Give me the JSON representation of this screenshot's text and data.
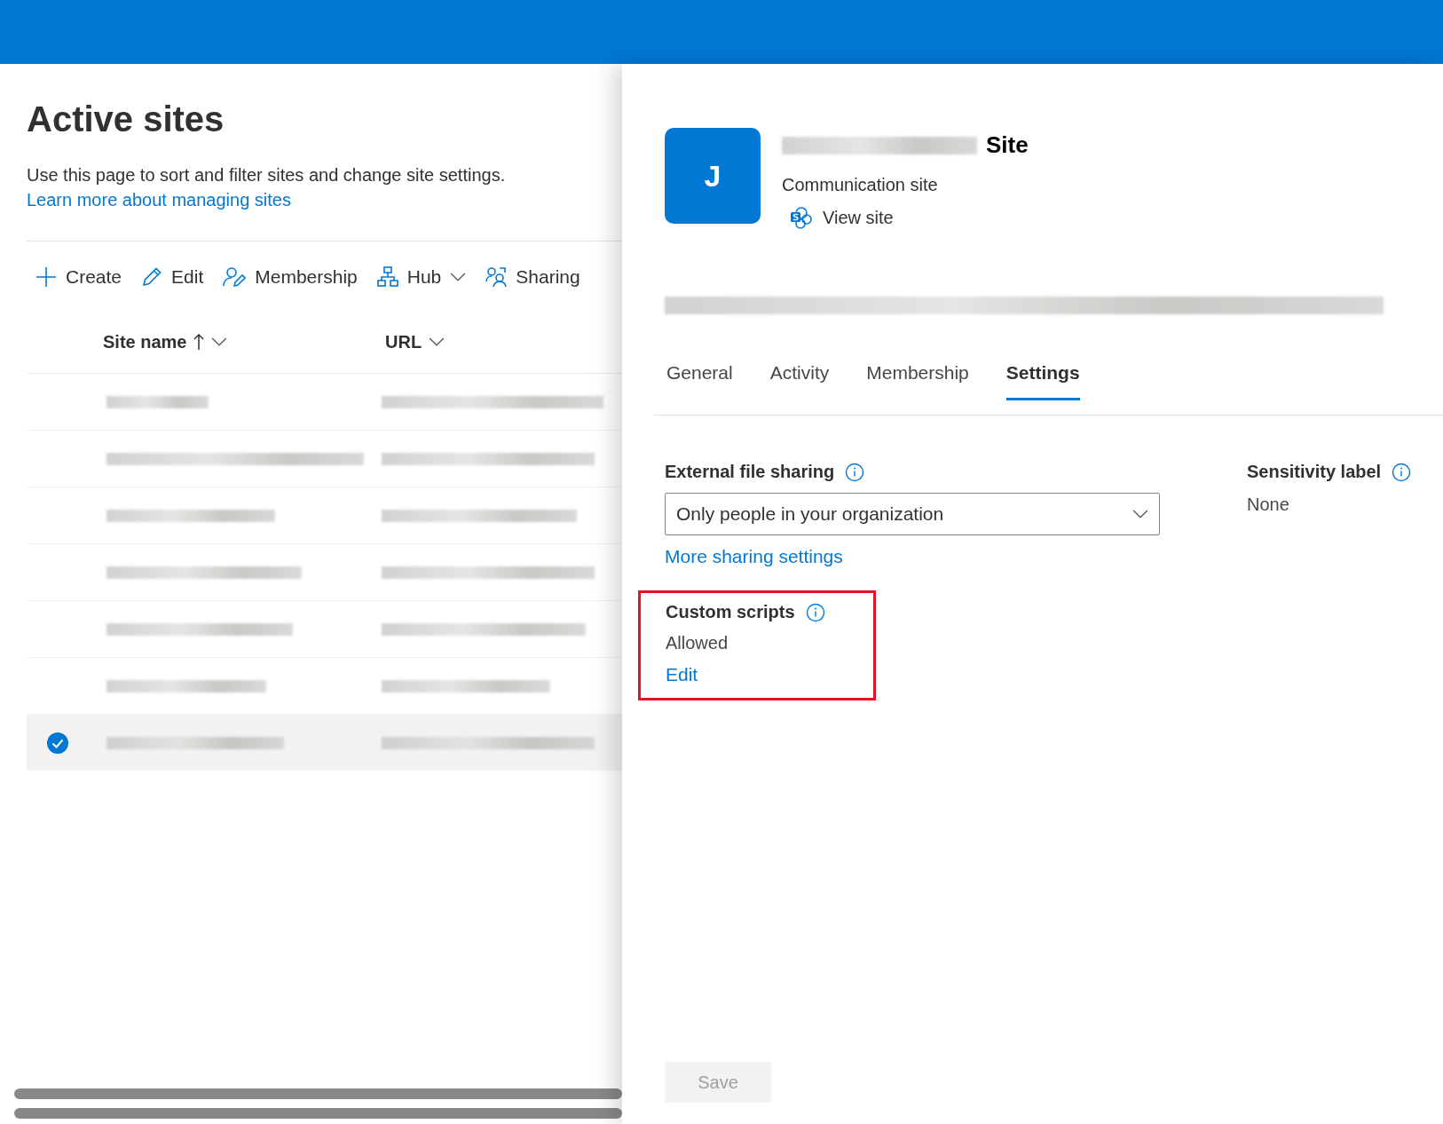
{
  "page": {
    "title": "Active sites",
    "description": "Use this page to sort and filter sites and change site settings.",
    "learn_more_link": "Learn more about managing sites"
  },
  "toolbar": [
    {
      "label": "Create",
      "kind": "plus"
    },
    {
      "label": "Edit",
      "kind": "pencil"
    },
    {
      "label": "Membership",
      "kind": "person"
    },
    {
      "label": "Hub",
      "kind": "hub"
    },
    {
      "label": "Sharing",
      "kind": "sharing"
    }
  ],
  "table": {
    "columns": [
      {
        "label": "Site name",
        "sorted": true
      },
      {
        "label": "URL",
        "sorted": false
      }
    ],
    "rows": [
      {
        "selected": false
      },
      {
        "selected": false
      },
      {
        "selected": false
      },
      {
        "selected": false
      },
      {
        "selected": false
      },
      {
        "selected": false
      },
      {
        "selected": true
      }
    ]
  },
  "panel": {
    "avatar_letter": "J",
    "title": "Site",
    "site_type": "Communication site",
    "view_site_link": "View site",
    "tabs": [
      {
        "label": "General",
        "selected": false
      },
      {
        "label": "Activity",
        "selected": false
      },
      {
        "label": "Membership",
        "selected": false
      },
      {
        "label": "Settings",
        "selected": true
      }
    ],
    "external_sharing": {
      "label": "External file sharing",
      "value": "Only people in your organization",
      "link": "More sharing settings"
    },
    "custom_scripts": {
      "label": "Custom scripts",
      "value": "Allowed",
      "link": "Edit",
      "highlighted": true
    },
    "sensitivity_label": {
      "label": "Sensitivity label",
      "value": "None"
    },
    "save_button": {
      "label": "Save",
      "disabled": true
    }
  }
}
